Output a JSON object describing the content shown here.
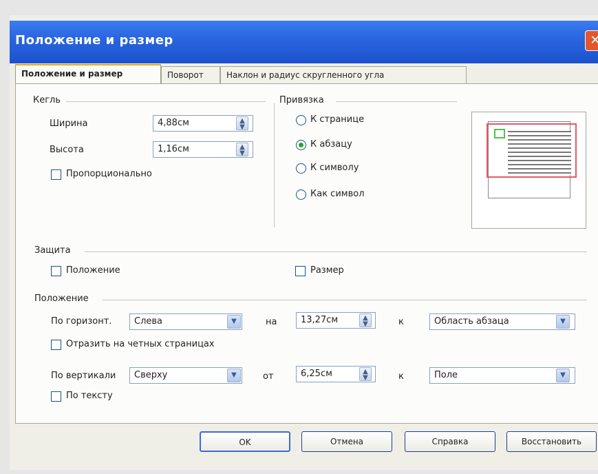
{
  "window": {
    "title": "Положение и размер",
    "close": "✕"
  },
  "tabs": [
    "Положение и размер",
    "Поворот",
    "Наклон и радиус скругленного угла"
  ],
  "size": {
    "legend": "Кегль",
    "width_label": "Ширина",
    "width_value": "4,88см",
    "height_label": "Высота",
    "height_value": "1,16см",
    "proportional": "Пропорционально"
  },
  "anchor": {
    "legend": "Привязка",
    "options": [
      "К странице",
      "К абзацу",
      "К символу",
      "Как символ"
    ],
    "selected": "К абзацу"
  },
  "protect": {
    "legend": "Защита",
    "position": "Положение",
    "size": "Размер"
  },
  "position": {
    "legend": "Положение",
    "h_label": "По горизонт.",
    "h_value": "Слева",
    "h_by": "на",
    "h_amount": "13,27см",
    "h_to": "к",
    "h_target": "Область абзаца",
    "mirror": "Отразить на четных страницах",
    "v_label": "По вертикали",
    "v_value": "Сверху",
    "v_by": "от",
    "v_amount": "6,25см",
    "v_to": "к",
    "v_target": "Поле",
    "follow_text": "По тексту"
  },
  "buttons": {
    "ok": "OK",
    "cancel": "Отмена",
    "help": "Справка",
    "reset": "Восстановить"
  }
}
